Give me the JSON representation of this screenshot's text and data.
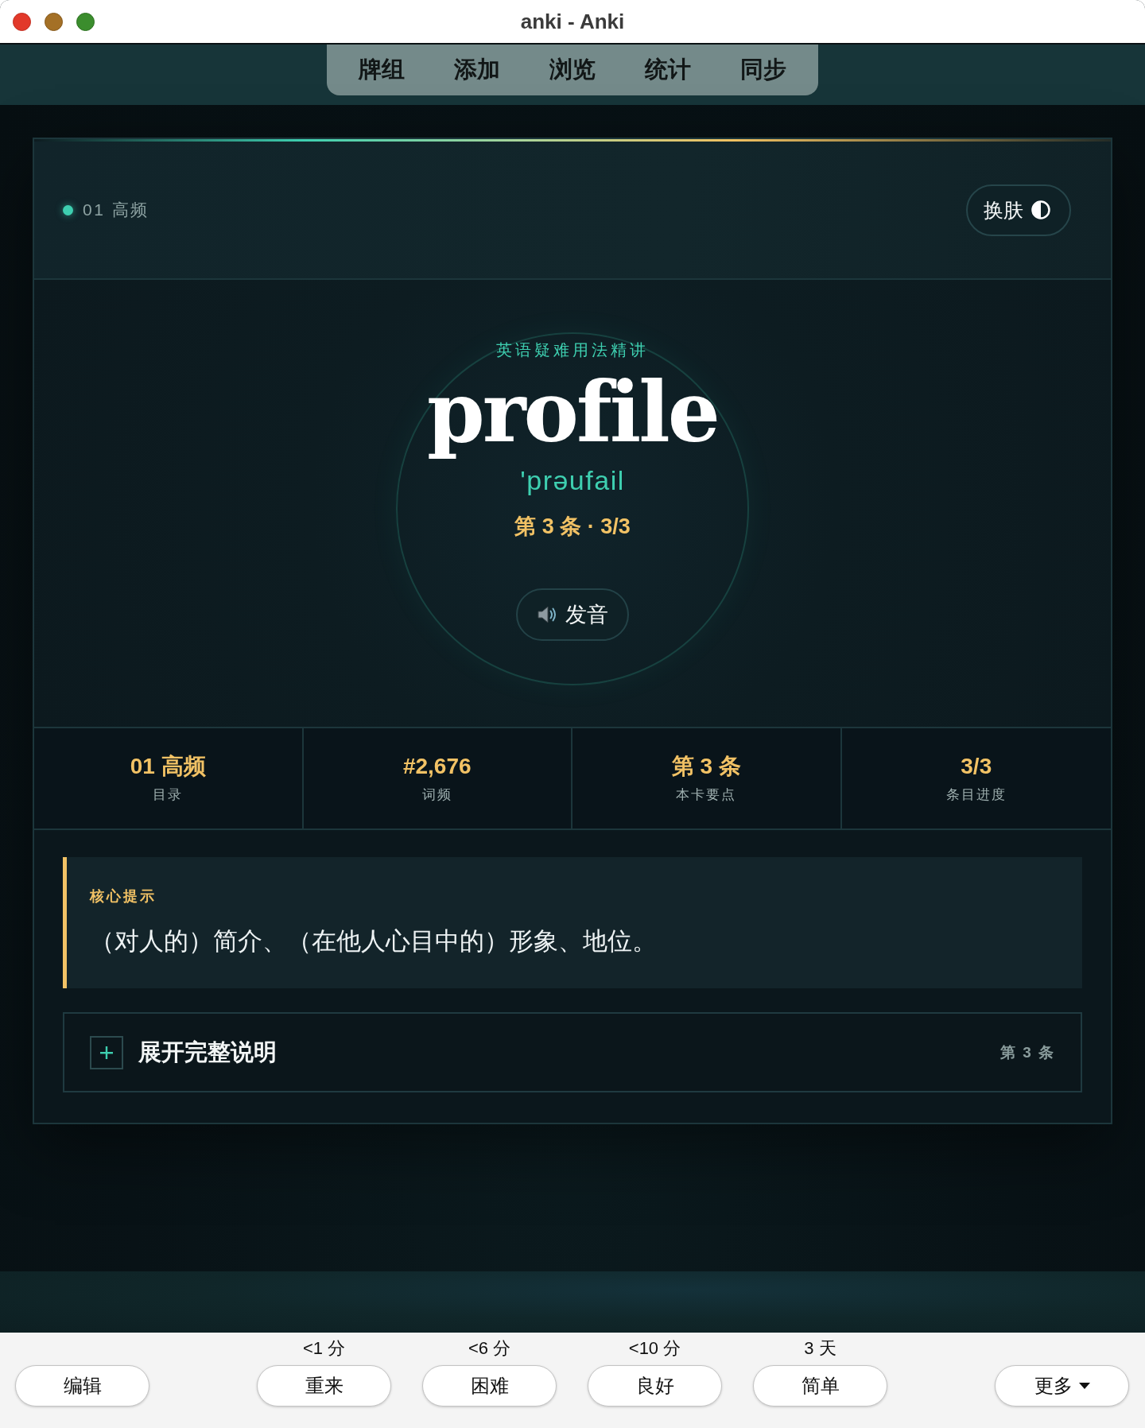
{
  "window": {
    "title": "anki - Anki"
  },
  "toolbar": {
    "items": [
      {
        "label": "牌组"
      },
      {
        "label": "添加"
      },
      {
        "label": "浏览"
      },
      {
        "label": "统计"
      },
      {
        "label": "同步"
      }
    ]
  },
  "card": {
    "header": {
      "deck_label": "01 高频",
      "skin_button": "换肤"
    },
    "hero": {
      "subtitle": "英语疑难用法精讲",
      "word": "profile",
      "phonetic": "'prəufail",
      "position": "第 3 条 · 3/3",
      "audio_button": "发音"
    },
    "stats": [
      {
        "value": "01 高频",
        "label": "目录"
      },
      {
        "value": "#2,676",
        "label": "词频"
      },
      {
        "value": "第 3 条",
        "label": "本卡要点"
      },
      {
        "value": "3/3",
        "label": "条目进度"
      }
    ],
    "hint": {
      "title": "核心提示",
      "text": "（对人的）简介、（在他人心目中的）形象、地位。"
    },
    "expander": {
      "label": "展开完整说明",
      "expanded": false,
      "note": "第 3 条"
    }
  },
  "answer_bar": {
    "edit_button": "编辑",
    "answers": [
      {
        "interval": "<1 分",
        "label": "重来"
      },
      {
        "interval": "<6 分",
        "label": "困难"
      },
      {
        "interval": "<10 分",
        "label": "良好"
      },
      {
        "interval": "3 天",
        "label": "简单"
      }
    ],
    "more_button": "更多"
  }
}
